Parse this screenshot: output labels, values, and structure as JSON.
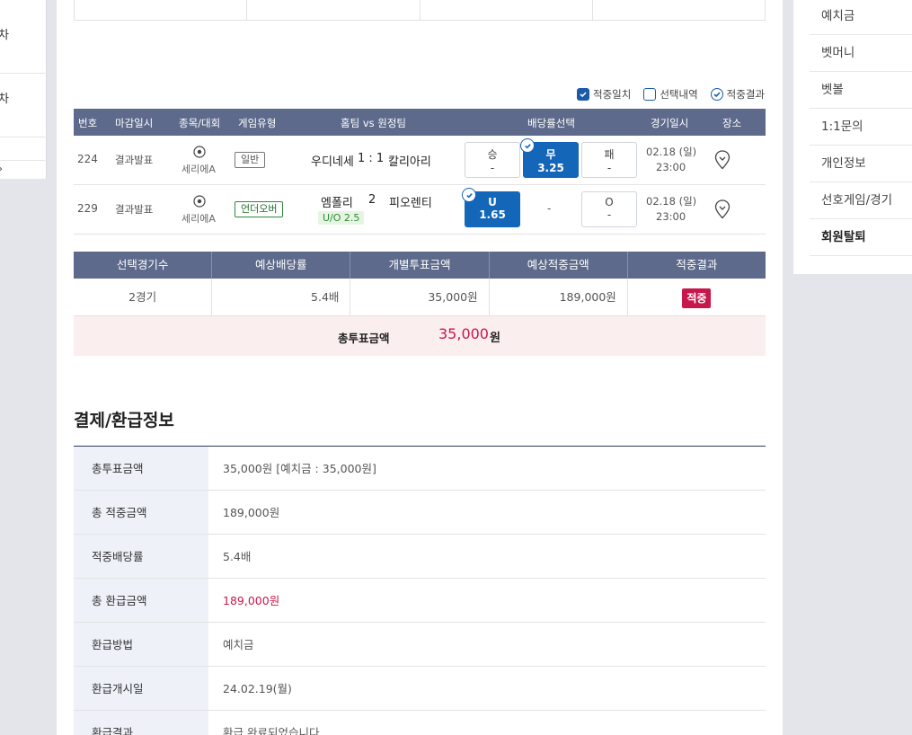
{
  "left_sidebar": {
    "items": [
      {
        "label": "차"
      },
      {
        "label": "차"
      }
    ]
  },
  "legend": {
    "items": [
      {
        "label": "적중일치",
        "style": "filled"
      },
      {
        "label": "선택내역",
        "style": "empty"
      },
      {
        "label": "적중결과",
        "style": "circle"
      }
    ]
  },
  "match_table": {
    "headers": [
      "번호",
      "마감일시",
      "종목/대회",
      "게임유형",
      "홈팀 vs 원정팀",
      "배당률선택",
      "경기일시",
      "장소"
    ],
    "rows": [
      {
        "no": "224",
        "deadline": "결과발표",
        "league": "세리에A",
        "type": "일반",
        "type_style": "gray",
        "home": "우디네세",
        "score": "1 : 1",
        "away": "칼리아리",
        "sub_badge": "",
        "odds": [
          {
            "label": "승",
            "value": "-",
            "selected": false
          },
          {
            "label": "무",
            "value": "3.25",
            "selected": true
          },
          {
            "label": "패",
            "value": "-",
            "selected": false
          }
        ],
        "date": "02.18 (일)",
        "time": "23:00"
      },
      {
        "no": "229",
        "deadline": "결과발표",
        "league": "세리에A",
        "type": "언더오버",
        "type_style": "green",
        "home": "엠폴리",
        "score": "2",
        "away": "피오렌티",
        "sub_badge": "U/O 2.5",
        "odds": [
          {
            "label": "U",
            "value": "1.65",
            "selected": true
          },
          {
            "label": "",
            "value": "-",
            "selected": false
          },
          {
            "label": "O",
            "value": "-",
            "selected": false
          }
        ],
        "date": "02.18 (일)",
        "time": "23:00"
      }
    ]
  },
  "summary": {
    "headers": [
      "선택경기수",
      "예상배당률",
      "개별투표금액",
      "예상적중금액",
      "적중결과"
    ],
    "row": {
      "games": "2경기",
      "odds": "5.4배",
      "bet": "35,000원",
      "expected": "189,000원",
      "result": "적중"
    },
    "total_label": "총투표금액",
    "total_value": "35,000",
    "total_unit": "원"
  },
  "payment": {
    "title": "결제/환급정보",
    "rows": [
      {
        "key": "총투표금액",
        "value": "35,000원 [예치금 : 35,000원]",
        "highlight": false
      },
      {
        "key": "총 적중금액",
        "value": "189,000원",
        "highlight": false
      },
      {
        "key": "적중배당률",
        "value": "5.4배",
        "highlight": false
      },
      {
        "key": "총 환급금액",
        "value": "189,000원",
        "highlight": true
      },
      {
        "key": "환급방법",
        "value": "예치금",
        "highlight": false
      },
      {
        "key": "환급개시일",
        "value": "24.02.19(월)",
        "highlight": false
      },
      {
        "key": "환급결과",
        "value": "환급 완료되었습니다",
        "highlight": false
      }
    ]
  },
  "right_sidebar": {
    "items": [
      {
        "label": "예치금"
      },
      {
        "label": "벳머니"
      },
      {
        "label": "벳볼"
      },
      {
        "label": "1:1문의"
      },
      {
        "label": "개인정보"
      },
      {
        "label": "선호게임/경기"
      },
      {
        "label": "회원탈퇴"
      }
    ]
  },
  "colors": {
    "header_bg": "#5d6a8b",
    "accent_blue": "#1466b8",
    "accent_red": "#c8174b",
    "total_bg": "#fbeeee"
  }
}
